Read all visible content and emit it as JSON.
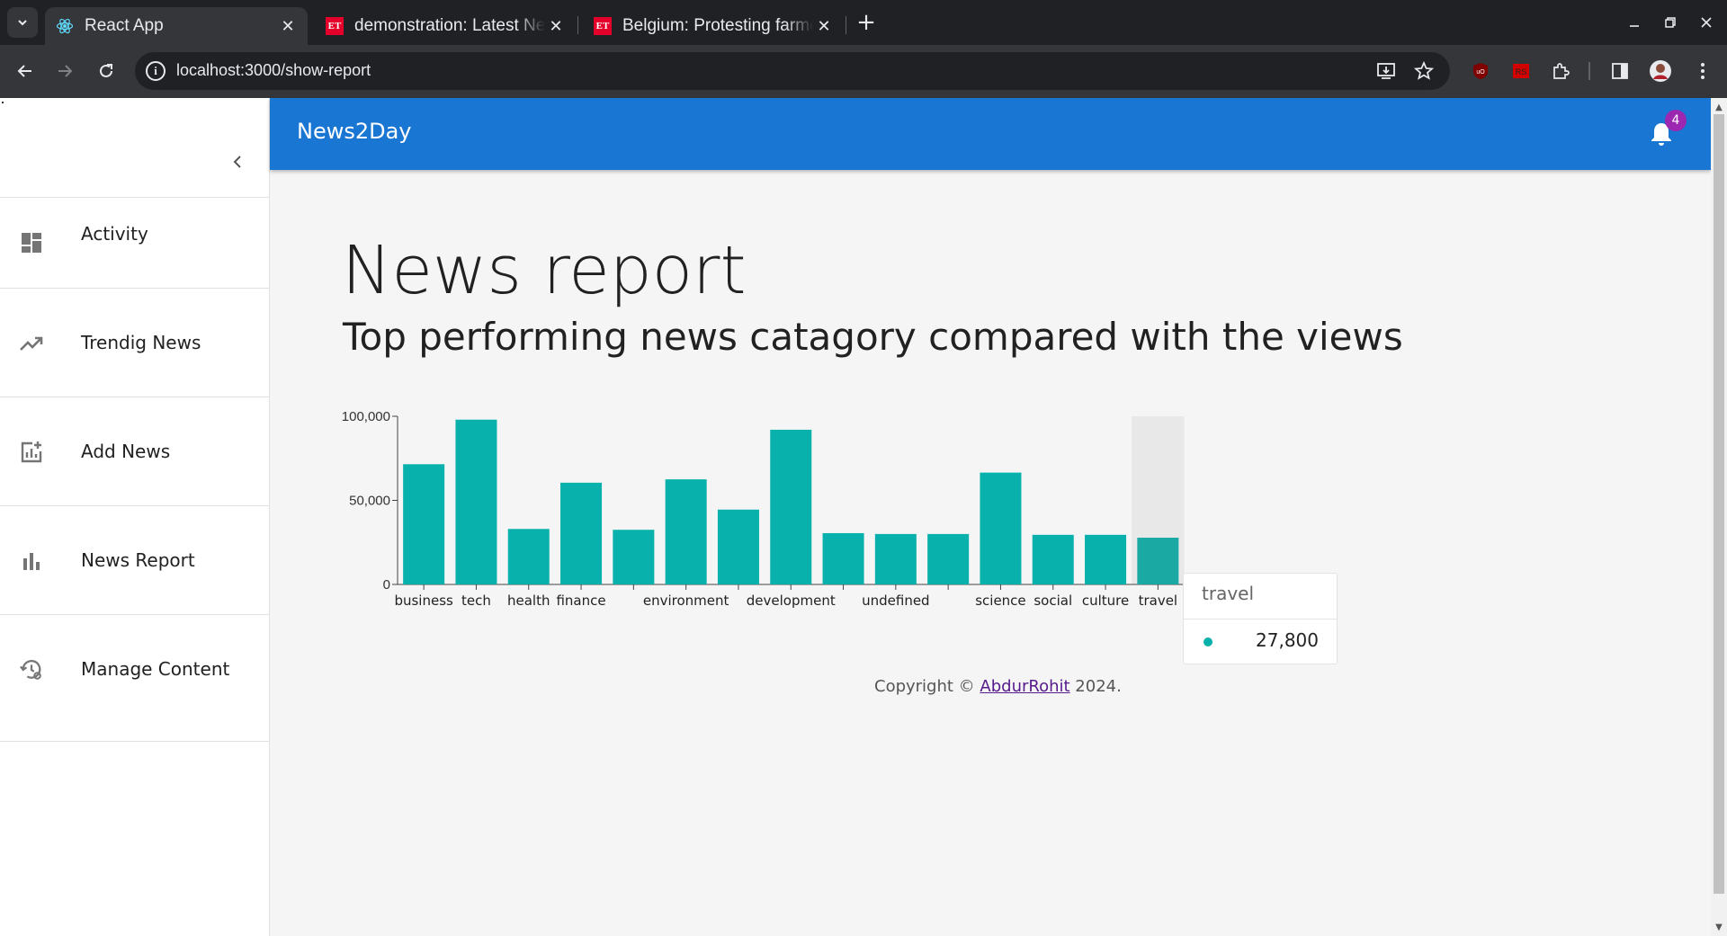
{
  "browser": {
    "tabs": [
      {
        "title": "React App",
        "favicon": "react-icon",
        "active": true
      },
      {
        "title": "demonstration: Latest News",
        "favicon": "et-icon",
        "active": false
      },
      {
        "title": "Belgium: Protesting farmers",
        "favicon": "et-icon",
        "active": false
      }
    ],
    "et_favicon_text": "ET",
    "url": "localhost:3000/show-report",
    "info_glyph": "i"
  },
  "sidebar": {
    "items": [
      {
        "label": "Activity",
        "icon": "dashboard-icon"
      },
      {
        "label": "Trendig News",
        "icon": "trending-up-icon"
      },
      {
        "label": "Add News",
        "icon": "add-chart-icon"
      },
      {
        "label": "News Report",
        "icon": "bar-chart-icon"
      },
      {
        "label": "Manage Content",
        "icon": "manage-history-icon"
      }
    ]
  },
  "appbar": {
    "brand": "News2Day",
    "notification_count": "4",
    "color": "#1976d2"
  },
  "main": {
    "title": "News report",
    "subtitle": "Top performing news catagory compared with the views"
  },
  "chart_data": {
    "type": "bar",
    "categories": [
      "business",
      "tech",
      "health",
      "finance",
      "",
      "environment",
      "",
      "development",
      "",
      "undefined",
      "",
      "science",
      "social",
      "culture",
      "travel"
    ],
    "values": [
      71500,
      98000,
      33000,
      60500,
      32500,
      62500,
      44500,
      92000,
      30500,
      30000,
      30000,
      66500,
      29500,
      29500,
      27800
    ],
    "ylim": [
      0,
      100000
    ],
    "yticks": [
      0,
      50000,
      100000
    ],
    "ytick_labels": [
      "0",
      "50,000",
      "100,000"
    ],
    "color": "#08b1ab",
    "highlight_index": 14,
    "tooltip": {
      "label": "travel",
      "value": "27,800"
    }
  },
  "footer": {
    "prefix": "Copyright © ",
    "link": "AbdurRohit",
    "suffix": " 2024."
  }
}
